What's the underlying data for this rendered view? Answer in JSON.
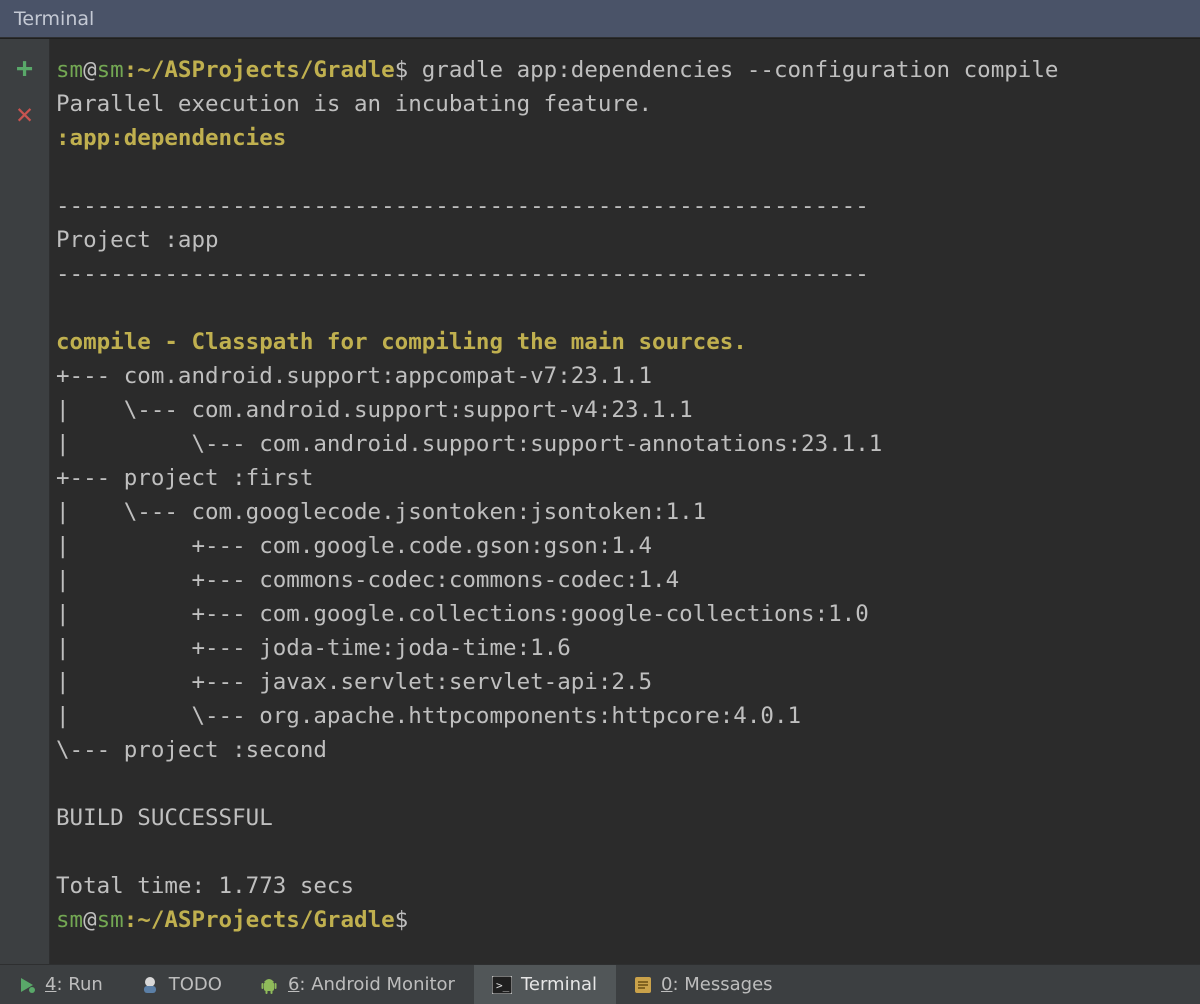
{
  "title": "Terminal",
  "gutter": {
    "add_tooltip": "New Session",
    "close_tooltip": "Close Session"
  },
  "prompt": {
    "user": "sm",
    "at": "@",
    "host": "sm",
    "colon": ":",
    "path": "~/ASProjects/Gradle",
    "dollar": "$"
  },
  "command": " gradle app:dependencies --configuration compile",
  "lines": {
    "parallel": "Parallel execution is an incubating feature.",
    "task": ":app:dependencies",
    "rule": "------------------------------------------------------------",
    "project": "Project :app",
    "compile": "compile - Classpath for compiling the main sources.",
    "d1": "+--- com.android.support:appcompat-v7:23.1.1",
    "d2": "|    \\--- com.android.support:support-v4:23.1.1",
    "d3": "|         \\--- com.android.support:support-annotations:23.1.1",
    "d4": "+--- project :first",
    "d5": "|    \\--- com.googlecode.jsontoken:jsontoken:1.1",
    "d6": "|         +--- com.google.code.gson:gson:1.4",
    "d7": "|         +--- commons-codec:commons-codec:1.4",
    "d8": "|         +--- com.google.collections:google-collections:1.0",
    "d9": "|         +--- joda-time:joda-time:1.6",
    "d10": "|         +--- javax.servlet:servlet-api:2.5",
    "d11": "|         \\--- org.apache.httpcomponents:httpcore:4.0.1",
    "d12": "\\--- project :second",
    "success": "BUILD SUCCESSFUL",
    "time": "Total time: 1.773 secs"
  },
  "bottom": {
    "run": {
      "key": "4",
      "label": ": Run"
    },
    "todo": {
      "label": "TODO"
    },
    "monitor": {
      "key": "6",
      "label": ": Android Monitor"
    },
    "terminal": {
      "label": "Terminal"
    },
    "messages": {
      "key": "0",
      "label": ": Messages"
    }
  }
}
